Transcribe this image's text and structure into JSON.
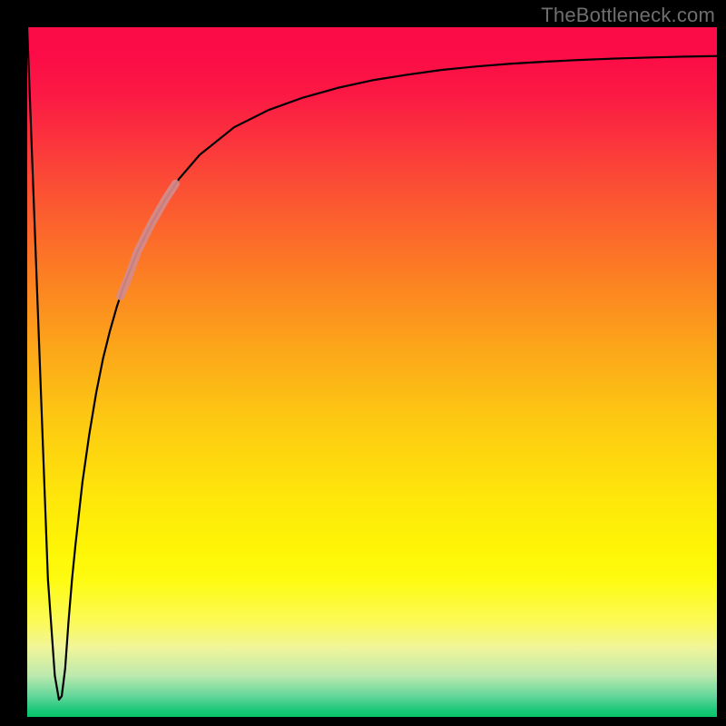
{
  "watermark": "TheBottleneck.com",
  "chart_data": {
    "type": "line",
    "title": "",
    "xlabel": "",
    "ylabel": "",
    "xlim": [
      0,
      100
    ],
    "ylim": [
      0,
      100
    ],
    "grid": false,
    "series": [
      {
        "name": "curve",
        "color": "#000000",
        "stroke_width": 2.2,
        "x": [
          0.0,
          1.5,
          3.0,
          4.0,
          4.6,
          5.0,
          5.5,
          6.0,
          6.5,
          7.0,
          8.0,
          9.0,
          10.0,
          11.0,
          12.0,
          13.0,
          14.0,
          16.0,
          18.0,
          20.0,
          22.0,
          25.0,
          30.0,
          35.0,
          40.0,
          45.0,
          50.0,
          55.0,
          60.0,
          65.0,
          70.0,
          75.0,
          80.0,
          85.0,
          90.0,
          95.0,
          100.0
        ],
        "y": [
          100.0,
          60.0,
          20.0,
          6.0,
          2.5,
          3.0,
          7.0,
          14.0,
          20.0,
          25.0,
          34.0,
          41.0,
          47.0,
          52.0,
          56.0,
          59.5,
          62.5,
          67.5,
          71.5,
          75.0,
          78.0,
          81.5,
          85.5,
          88.0,
          89.8,
          91.2,
          92.3,
          93.1,
          93.8,
          94.3,
          94.7,
          95.0,
          95.25,
          95.45,
          95.6,
          95.73,
          95.82
        ]
      },
      {
        "name": "highlight-segment",
        "color": "#d58b8b",
        "stroke_width": 9,
        "opacity": 0.92,
        "x": [
          13.5,
          14.5,
          16.0,
          18.0,
          20.0,
          21.5
        ],
        "y": [
          61.0,
          63.3,
          67.5,
          71.5,
          75.0,
          77.3
        ]
      }
    ]
  }
}
